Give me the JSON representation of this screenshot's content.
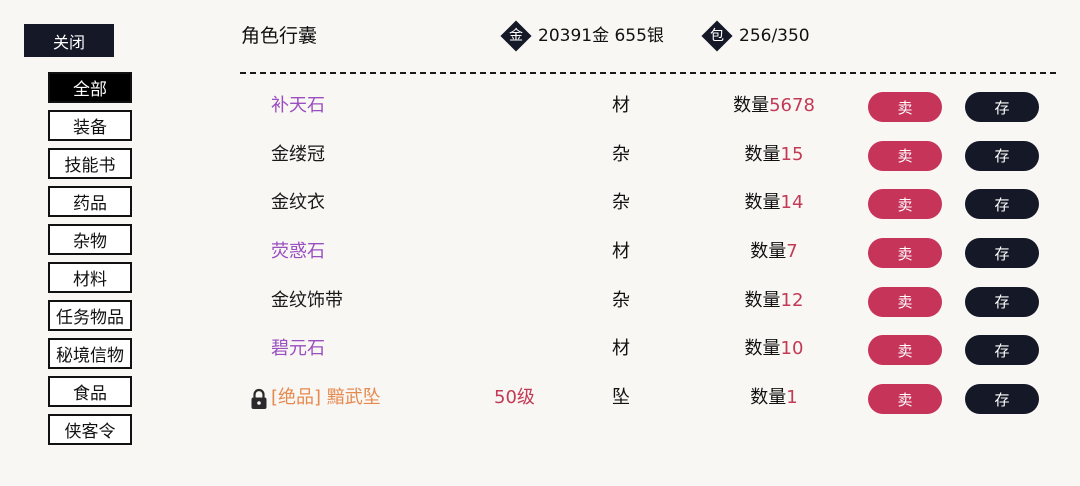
{
  "close_label": "关闭",
  "categories": [
    {
      "label": "全部",
      "active": true
    },
    {
      "label": "装备",
      "active": false
    },
    {
      "label": "技能书",
      "active": false
    },
    {
      "label": "药品",
      "active": false
    },
    {
      "label": "杂物",
      "active": false
    },
    {
      "label": "材料",
      "active": false
    },
    {
      "label": "任务物品",
      "active": false
    },
    {
      "label": "秘境信物",
      "active": false
    },
    {
      "label": "食品",
      "active": false
    },
    {
      "label": "侠客令",
      "active": false
    }
  ],
  "header": {
    "title": "角色行囊",
    "gold_icon": "金",
    "money": "20391金 655银",
    "bag_icon": "包",
    "capacity": "256/350"
  },
  "quantity_label": "数量",
  "sell_label": "卖",
  "store_label": "存",
  "colors": {
    "sell": "#c7345a",
    "dark": "#141827",
    "purple_quality": "#9a4fc0",
    "orange_quality": "#e6894f",
    "quantity_value": "#c23a55"
  },
  "items": [
    {
      "name": "补天石",
      "quality": "purple",
      "locked": false,
      "level": "",
      "type": "材",
      "quantity": "5678"
    },
    {
      "name": "金缕冠",
      "quality": "normal",
      "locked": false,
      "level": "",
      "type": "杂",
      "quantity": "15"
    },
    {
      "name": "金纹衣",
      "quality": "normal",
      "locked": false,
      "level": "",
      "type": "杂",
      "quantity": "14"
    },
    {
      "name": "荧惑石",
      "quality": "purple",
      "locked": false,
      "level": "",
      "type": "材",
      "quantity": "7"
    },
    {
      "name": "金纹饰带",
      "quality": "normal",
      "locked": false,
      "level": "",
      "type": "杂",
      "quantity": "12"
    },
    {
      "name": "碧元石",
      "quality": "purple",
      "locked": false,
      "level": "",
      "type": "材",
      "quantity": "10"
    },
    {
      "name": "[绝品] 黯武坠",
      "quality": "orange",
      "locked": true,
      "level": "50级",
      "type": "坠",
      "quantity": "1"
    }
  ]
}
